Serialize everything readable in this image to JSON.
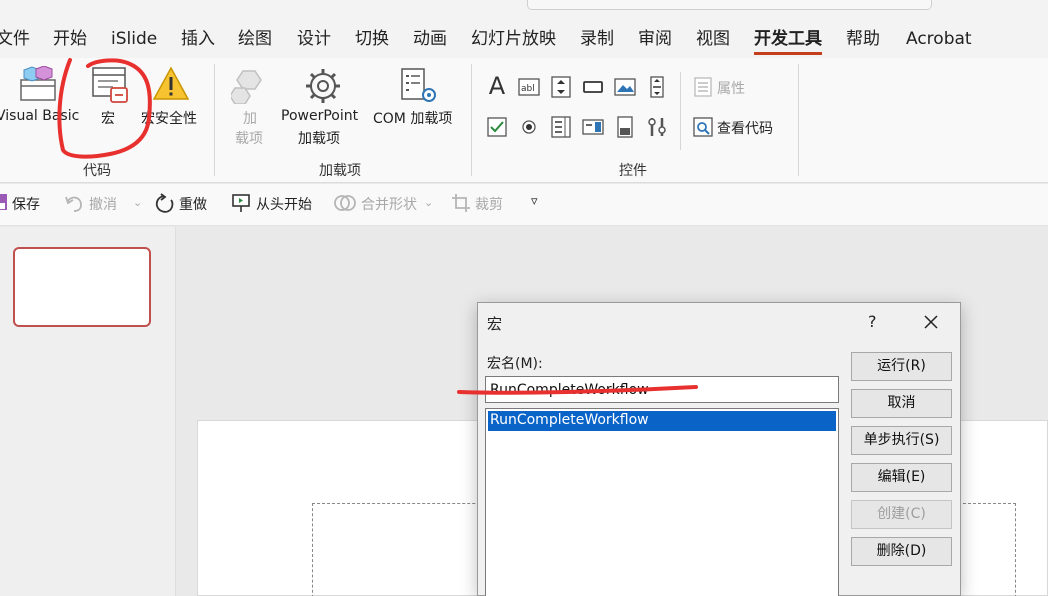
{
  "tabs": [
    {
      "label": "文件"
    },
    {
      "label": "开始"
    },
    {
      "label": "iSlide"
    },
    {
      "label": "插入"
    },
    {
      "label": "绘图"
    },
    {
      "label": "设计"
    },
    {
      "label": "切换"
    },
    {
      "label": "动画"
    },
    {
      "label": "幻灯片放映"
    },
    {
      "label": "录制"
    },
    {
      "label": "审阅"
    },
    {
      "label": "视图"
    },
    {
      "label": "开发工具",
      "active": true
    },
    {
      "label": "帮助"
    },
    {
      "label": "Acrobat"
    }
  ],
  "ribbon": {
    "code_group": {
      "label": "代码",
      "visual_basic": "Visual Basic",
      "macro": "宏",
      "macro_security": "宏安全性"
    },
    "addins_group": {
      "label": "加载项",
      "addins_line1": "加",
      "addins_line2": "载项",
      "ppt_addins_line1": "PowerPoint",
      "ppt_addins_line2": "加载项",
      "com_addins": "COM 加载项"
    },
    "controls_group": {
      "label": "控件",
      "properties": "属性",
      "view_code": "查看代码"
    }
  },
  "quick_toolbar": {
    "save": "保存",
    "undo": "撤消",
    "redo": "重做",
    "from_beginning": "从头开始",
    "merge_shapes": "合并形状",
    "crop": "裁剪"
  },
  "dialog": {
    "title": "宏",
    "help": "?",
    "name_label": "宏名(M):",
    "name_value": "RunCompleteWorkflow",
    "list_items": [
      "RunCompleteWorkflow"
    ],
    "buttons": {
      "run": "运行(R)",
      "cancel": "取消",
      "step_into": "单步执行(S)",
      "edit": "编辑(E)",
      "create": "创建(C)",
      "delete": "删除(D)"
    }
  },
  "colors": {
    "accent": "#c43e1c",
    "selection": "#0a64c8",
    "annotation": "#e8312f"
  }
}
